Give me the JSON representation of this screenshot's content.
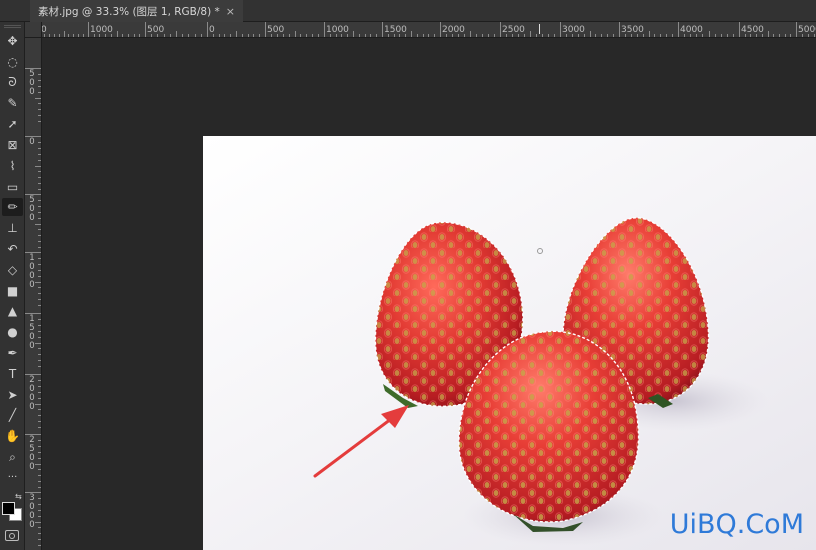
{
  "document": {
    "tab_title": "素材.jpg @ 33.3% (图层 1, RGB/8) *",
    "close_glyph": "×"
  },
  "ruler_top_labels": [
    "0",
    "1000",
    "500",
    "0",
    "500",
    "1000",
    "1500",
    "2000",
    "2500",
    "3000",
    "3500",
    "4000",
    "4500",
    "5000"
  ],
  "ruler_left_labels": [
    "5\n0\n0",
    "0",
    "5\n0\n0",
    "1\n0\n0\n0",
    "1\n5\n0\n0",
    "2\n0\n0\n0",
    "2\n5\n0\n0",
    "3\n0\n0\n0"
  ],
  "tools": [
    {
      "name": "move-tool",
      "glyph": "✥"
    },
    {
      "name": "elliptical-marquee-tool",
      "glyph": "◌"
    },
    {
      "name": "lasso-tool",
      "glyph": "ᘐ"
    },
    {
      "name": "quick-selection-tool",
      "glyph": "✎"
    },
    {
      "name": "pen-arrow-tool",
      "glyph": "➚"
    },
    {
      "name": "frame-tool",
      "glyph": "⊠"
    },
    {
      "name": "eyedropper-tool",
      "glyph": "⌇"
    },
    {
      "name": "healing-brush-tool",
      "glyph": "▭"
    },
    {
      "name": "brush-tool",
      "glyph": "✏"
    },
    {
      "name": "clone-stamp-tool",
      "glyph": "⊥"
    },
    {
      "name": "history-brush-tool",
      "glyph": "↶"
    },
    {
      "name": "eraser-tool",
      "glyph": "◇"
    },
    {
      "name": "gradient-tool",
      "glyph": "■"
    },
    {
      "name": "blur-tool",
      "glyph": "▲"
    },
    {
      "name": "dodge-tool",
      "glyph": "●"
    },
    {
      "name": "pen-tool",
      "glyph": "✒"
    },
    {
      "name": "type-tool",
      "glyph": "T"
    },
    {
      "name": "path-selection-tool",
      "glyph": "➤"
    },
    {
      "name": "line-tool",
      "glyph": "╱"
    },
    {
      "name": "hand-tool",
      "glyph": "✋"
    },
    {
      "name": "zoom-tool",
      "glyph": "⌕"
    },
    {
      "name": "more-tools",
      "glyph": "···"
    }
  ],
  "colors": {
    "foreground": "#000000",
    "background": "#ffffff",
    "strawberry": "#d9302f",
    "watermark": "#2f7ad8",
    "arrow": "#e43c3c"
  },
  "watermark": "UiBQ.CoM"
}
